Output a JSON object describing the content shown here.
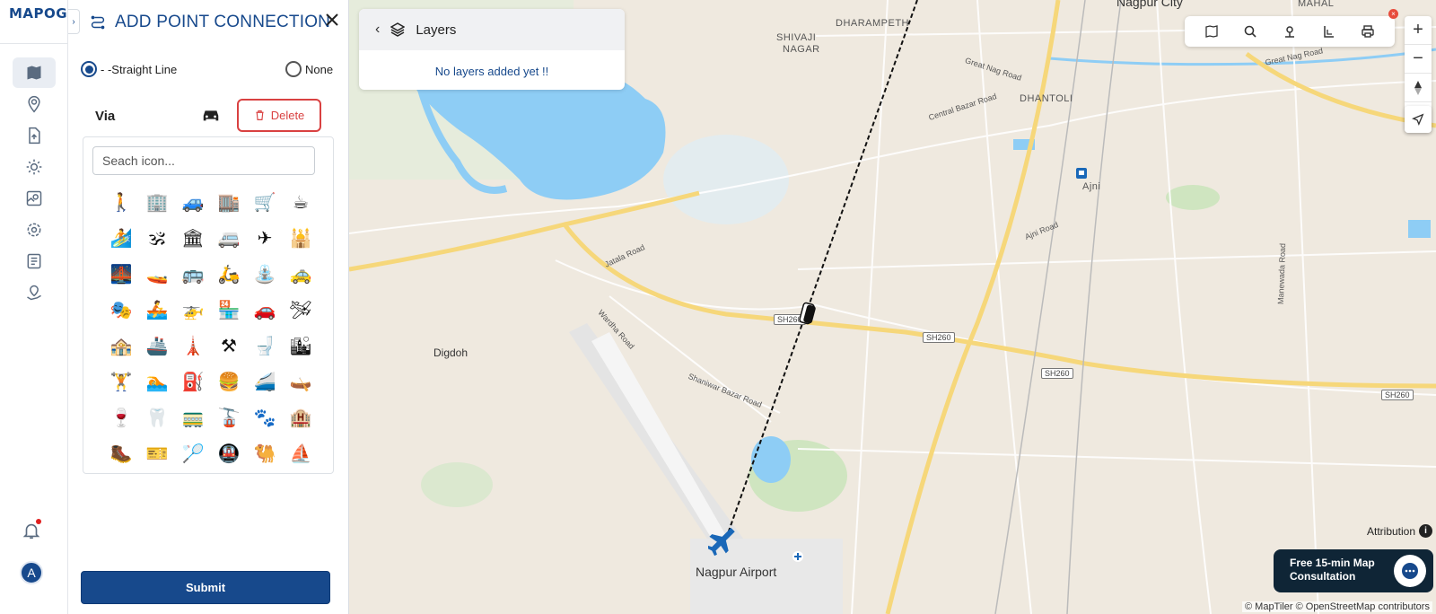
{
  "app": {
    "logo_text": "MAPOG"
  },
  "rail": {
    "items": [
      {
        "name": "map-icon",
        "active": true
      },
      {
        "name": "location-pin-icon"
      },
      {
        "name": "upload-icon"
      },
      {
        "name": "gear-icon"
      },
      {
        "name": "map-chart-icon"
      },
      {
        "name": "settings-icon"
      },
      {
        "name": "report-icon"
      },
      {
        "name": "map-marker-hand-icon"
      }
    ],
    "avatar_initial": "A"
  },
  "panel": {
    "title": "ADD POINT CONNECTION",
    "options": {
      "straight_line": "- -Straight Line",
      "none": "None",
      "selected": "straight_line"
    },
    "via_label": "Via",
    "delete_label": "Delete",
    "search_placeholder": "Seach icon...",
    "submit_label": "Submit",
    "icons": [
      "🚶",
      "🏢",
      "🚙",
      "🏬",
      "🛒",
      "☕",
      "🏄",
      "🕉",
      "🏛",
      "🚐",
      "✈",
      "🕌",
      "🌉",
      "🚤",
      "🚌",
      "🛵",
      "⛲",
      "🚕",
      "🎭",
      "🚣",
      "🚁",
      "🏪",
      "🚗",
      "🛩",
      "🏤",
      "🚢",
      "🗼",
      "⚒",
      "🚽",
      "🏙",
      "🏋",
      "🏊",
      "⛽",
      "🍔",
      "🚄",
      "🛶",
      "🍷",
      "🦷",
      "🚃",
      "🚡",
      "🐾",
      "🏨",
      "🥾",
      "🎫",
      "🏸",
      "🚇",
      "🐫",
      "⛵"
    ]
  },
  "layers": {
    "title": "Layers",
    "empty_text": "No layers added yet !!"
  },
  "map": {
    "labels": {
      "nagpur_city": "Nagpur City",
      "dharampeth": "DHARAMPETH",
      "shivaji": "SHIVAJI",
      "nagar": "NAGAR",
      "dhantoli": "DHANTOLI",
      "mahal": "MAHAL",
      "ajni": "Ajni",
      "digdoh": "Digdoh",
      "airport": "Nagpur Airport"
    },
    "roads": {
      "great_nag": "Great Nag Road",
      "great_nag2": "Great Nag Road",
      "central_bazar": "Central Bazar Road",
      "jatala": "Jatala Road",
      "wardha": "Wardha Road",
      "shaniwar": "Shaniwar Bazar Road",
      "ajni_road": "Ajni Road",
      "manewada": "Manewada Road"
    },
    "shields": [
      "SH260",
      "SH260",
      "SH260",
      "SH260"
    ],
    "attribution": "Attribution",
    "copyright": "© MapTiler © OpenStreetMap contributors",
    "consult_line1": "Free 15-min Map",
    "consult_line2": "Consultation"
  },
  "colors": {
    "brand": "#17498c",
    "danger": "#d94141",
    "water": "#8ecdf5",
    "road_major": "#f6d77a"
  }
}
